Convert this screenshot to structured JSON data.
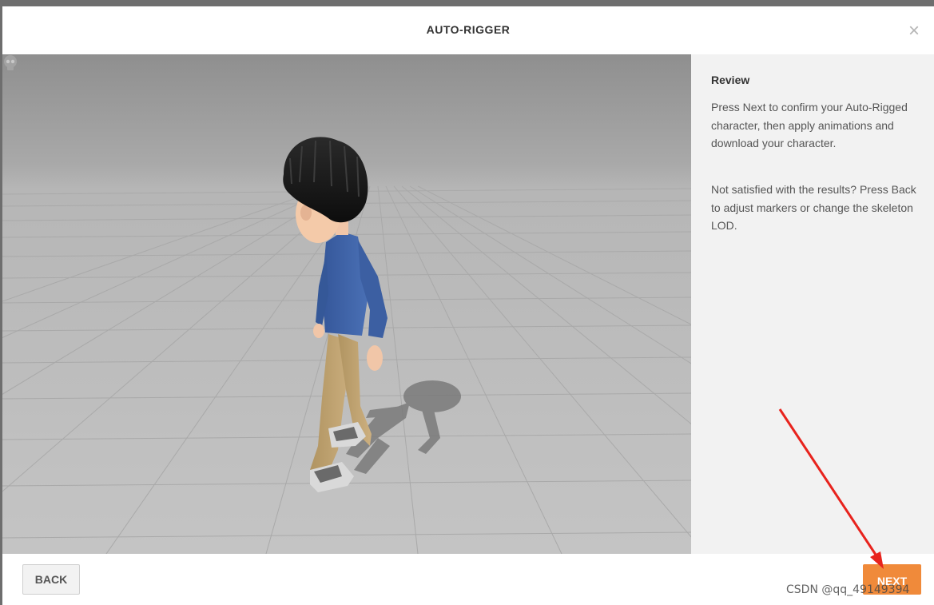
{
  "dialog": {
    "title": "AUTO-RIGGER",
    "close_icon": "close-icon"
  },
  "side_panel": {
    "heading": "Review",
    "paragraph_1": "Press Next to confirm your Auto-Rigged character, then apply animations and download your character.",
    "paragraph_2": "Not satisfied with the results? Press Back to adjust markers or change the skeleton LOD."
  },
  "footer": {
    "back_label": "BACK",
    "next_label": "NEXT"
  },
  "viewport": {
    "left_icon": "skull-icon",
    "annotation": "red-arrow-pointing-to-next"
  },
  "watermark": "CSDN @qq_49149394",
  "colors": {
    "next_button": "#f08a3a",
    "arrow": "#e8231d",
    "shirt": "#3f64a8",
    "pants": "#c2a574",
    "hair": "#1a1a1a"
  }
}
